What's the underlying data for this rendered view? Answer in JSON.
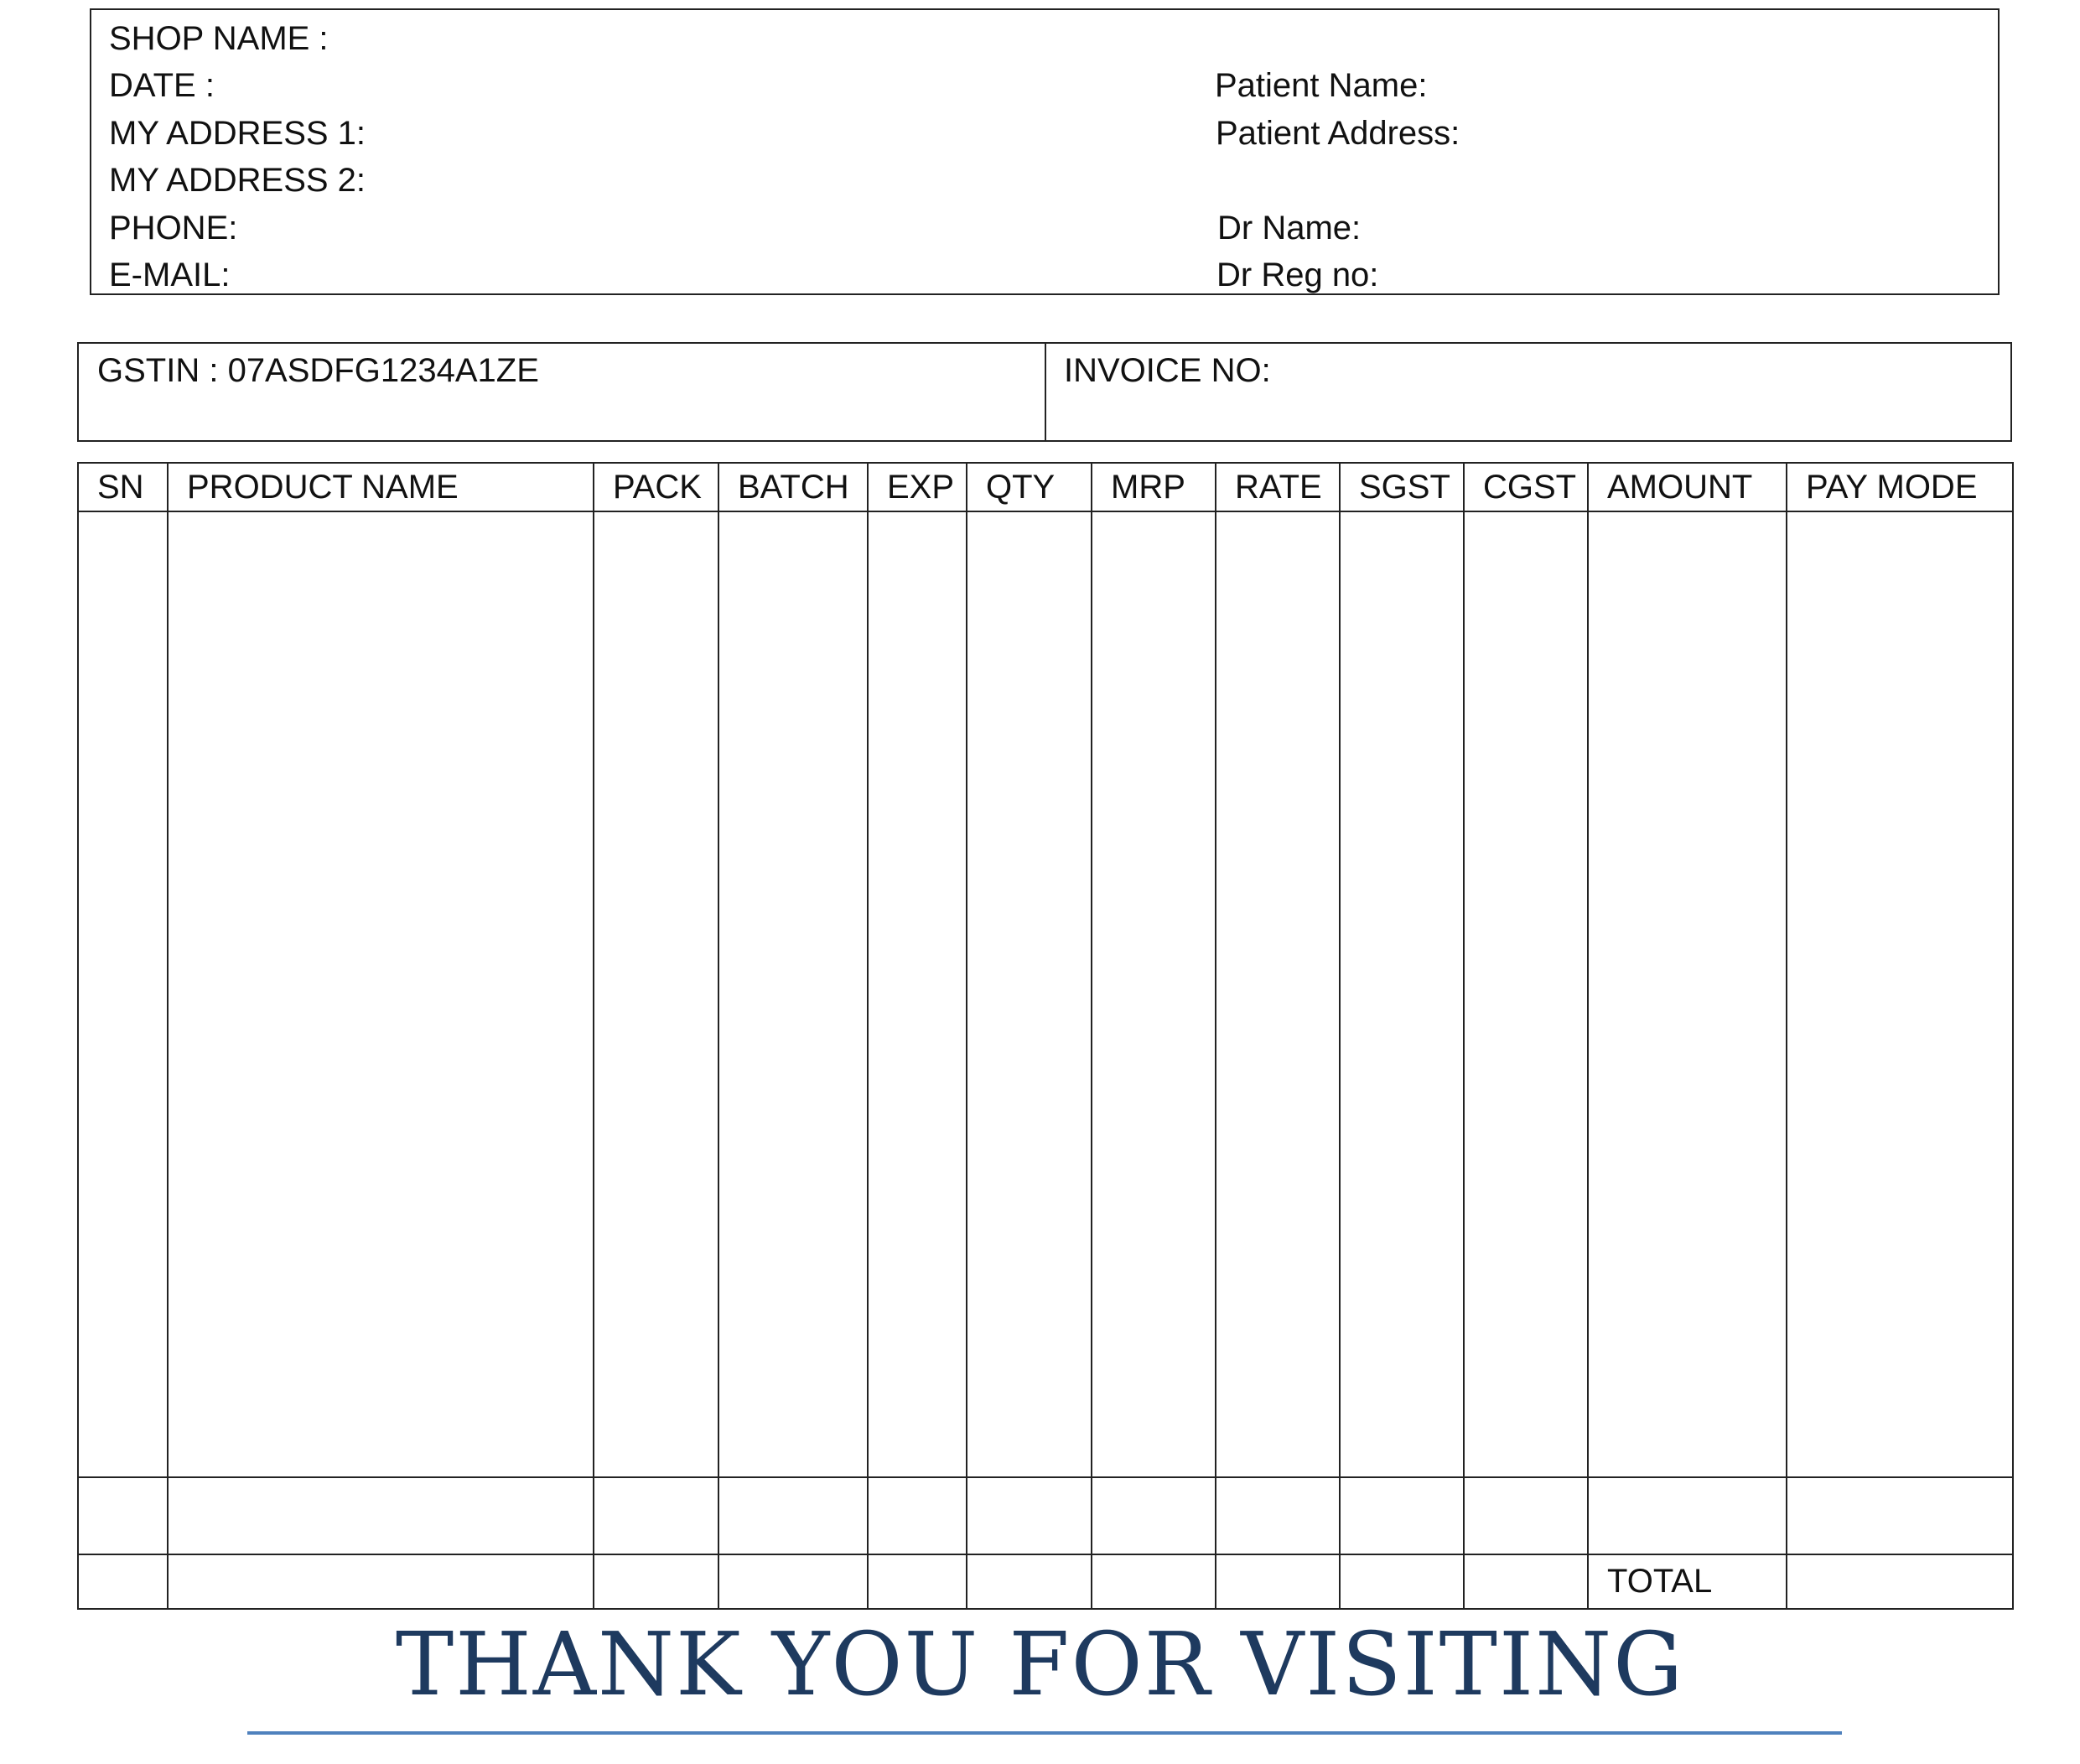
{
  "seller": {
    "shop_name_label": "SHOP NAME :",
    "date_label": "DATE :",
    "address1_label": "MY ADDRESS 1:",
    "address2_label": "MY ADDRESS 2:",
    "phone_label": "PHONE:",
    "email_label": "E-MAIL:"
  },
  "patient": {
    "name_label": "Patient Name:",
    "address_label": "Patient Address:",
    "dr_name_label": "Dr Name:",
    "dr_reg_label": "Dr Reg no:"
  },
  "tax": {
    "gstin": "GSTIN : 07ASDFG1234A1ZE",
    "invoice_label": "INVOICE NO:"
  },
  "table": {
    "headers": [
      "SN",
      "PRODUCT NAME",
      "PACK",
      "BATCH",
      "EXP",
      "QTY",
      "MRP",
      "RATE",
      "SGST",
      "CGST",
      "AMOUNT",
      "PAY MODE"
    ],
    "total_label": "TOTAL"
  },
  "footer": {
    "thanks": "THANK YOU FOR VISITING"
  },
  "colors": {
    "footer_text": "#1e3a5f",
    "footer_rule": "#4f81bd",
    "border": "#222222"
  }
}
